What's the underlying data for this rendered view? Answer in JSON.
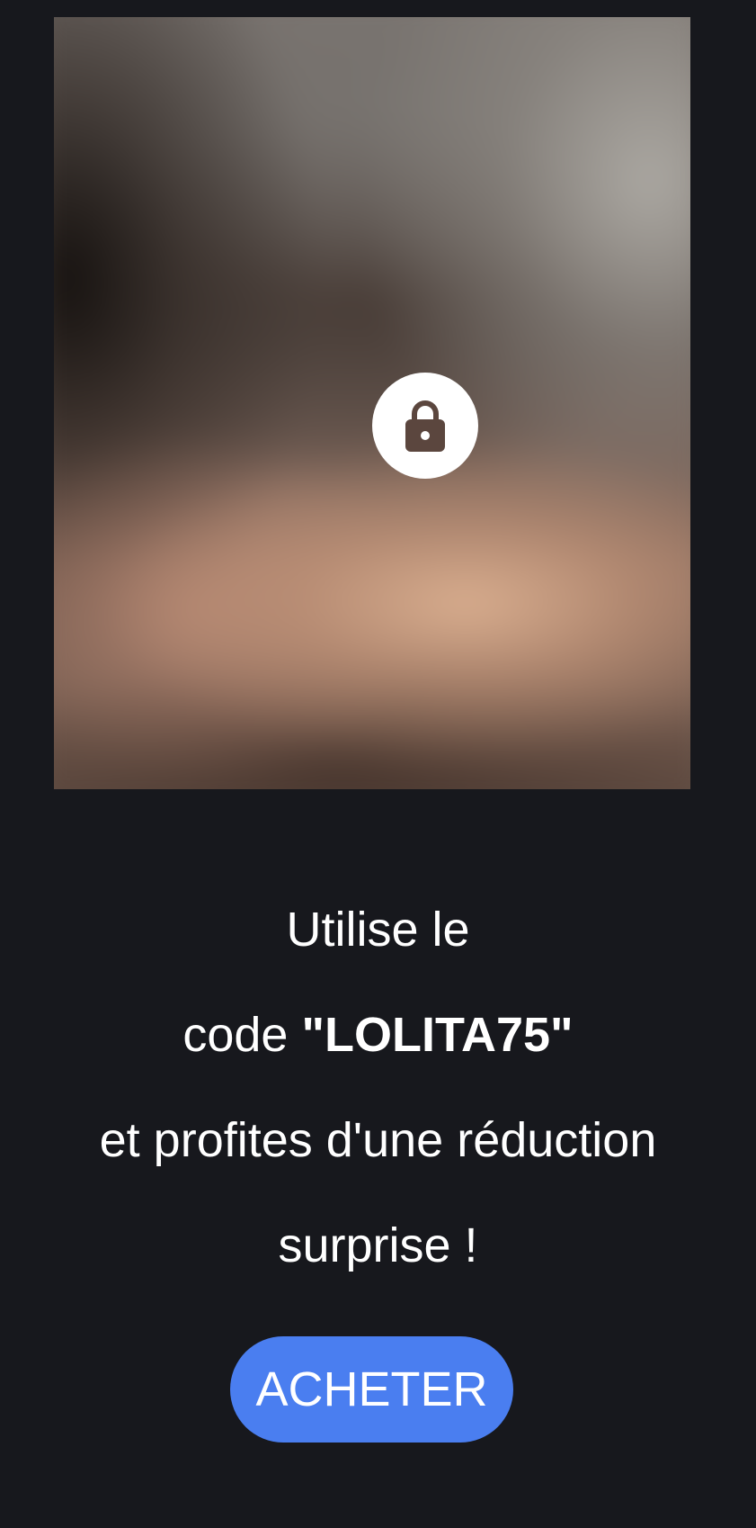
{
  "media": {
    "lock_icon": "lock-icon",
    "locked": true
  },
  "promo": {
    "line1": "Utilise le",
    "line2_prefix": "code ",
    "code": "\"LOLITA75\"",
    "line3": "et profites d'une réduction",
    "line4": "surprise !"
  },
  "buy_button": {
    "label": "ACHETER",
    "color": "#4a7ef0"
  },
  "theme": {
    "background": "#17181d",
    "text": "#ffffff"
  }
}
